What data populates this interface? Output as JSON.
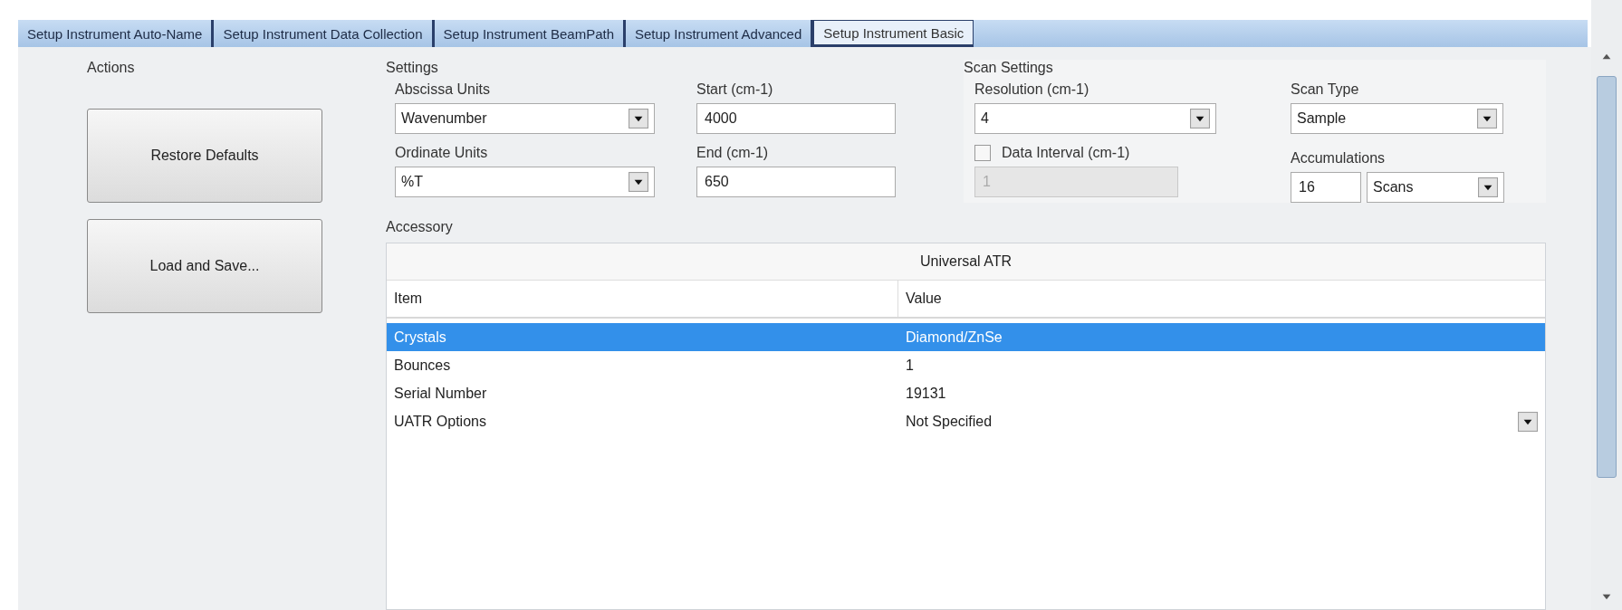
{
  "tabs": [
    {
      "label": "Setup Instrument Auto-Name",
      "selected": false
    },
    {
      "label": "Setup Instrument Data Collection",
      "selected": false
    },
    {
      "label": "Setup Instrument BeamPath",
      "selected": false
    },
    {
      "label": "Setup Instrument Advanced",
      "selected": false
    },
    {
      "label": "Setup Instrument Basic",
      "selected": true
    }
  ],
  "actions": {
    "label": "Actions",
    "buttons": [
      "Restore Defaults",
      "Load and Save..."
    ]
  },
  "settings": {
    "label": "Settings",
    "fields": [
      {
        "kind": "dropdown",
        "label": "Abscissa Units",
        "value": "Wavenumber"
      },
      {
        "kind": "text",
        "label": "Start (cm-1)",
        "value": "4000"
      },
      {
        "kind": "dropdown",
        "label": "Ordinate Units",
        "value": "%T"
      },
      {
        "kind": "text",
        "label": "End (cm-1)",
        "value": "650"
      }
    ]
  },
  "scan_settings": {
    "label": "Scan Settings",
    "resolution": {
      "label": "Resolution (cm-1)",
      "value": "4"
    },
    "data_interval": {
      "label": "Data Interval (cm-1)",
      "checked": false,
      "value": "1",
      "disabled": true
    },
    "scan_type": {
      "label": "Scan Type",
      "value": "Sample"
    },
    "accumulations": {
      "label": "Accumulations",
      "value": "16",
      "unit": "Scans"
    }
  },
  "accessory": {
    "label": "Accessory",
    "title": "Universal ATR",
    "columns": [
      "Item",
      "Value"
    ],
    "rows": [
      {
        "item": "Crystals",
        "value": "Diamond/ZnSe",
        "selected": true,
        "dropdown": false
      },
      {
        "item": "Bounces",
        "value": "1",
        "selected": false,
        "dropdown": false
      },
      {
        "item": "Serial Number",
        "value": "19131",
        "selected": false,
        "dropdown": false
      },
      {
        "item": "UATR Options",
        "value": "Not Specified",
        "selected": false,
        "dropdown": true
      }
    ]
  }
}
